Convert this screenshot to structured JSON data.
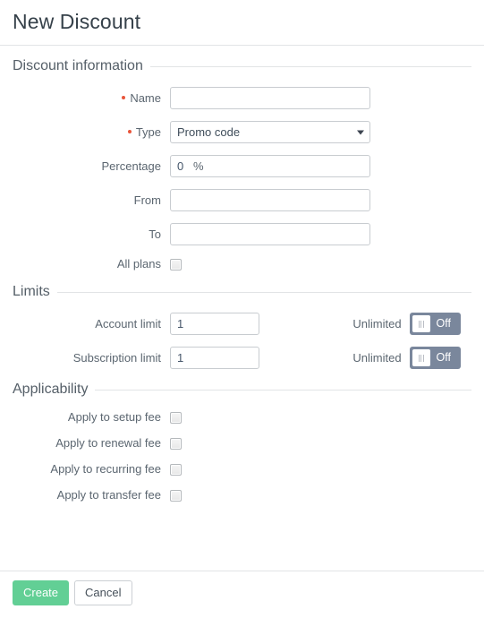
{
  "header": {
    "title": "New Discount"
  },
  "sections": {
    "discount_information": {
      "legend": "Discount information",
      "fields": {
        "name": {
          "label": "Name",
          "required": true,
          "value": "",
          "placeholder": ""
        },
        "type": {
          "label": "Type",
          "required": true,
          "selected": "Promo code",
          "caret_icon": "chevron-down-icon"
        },
        "percentage": {
          "label": "Percentage",
          "required": false,
          "value": "0",
          "suffix": "%"
        },
        "from": {
          "label": "From",
          "required": false,
          "value": "",
          "placeholder": ""
        },
        "to": {
          "label": "To",
          "required": false,
          "value": "",
          "placeholder": ""
        },
        "all_plans": {
          "label": "All plans",
          "checked": false
        }
      }
    },
    "limits": {
      "legend": "Limits",
      "rows": [
        {
          "label": "Account limit",
          "value": "1",
          "unlimited_label": "Unlimited",
          "toggle_state": "Off"
        },
        {
          "label": "Subscription limit",
          "value": "1",
          "unlimited_label": "Unlimited",
          "toggle_state": "Off"
        }
      ]
    },
    "applicability": {
      "legend": "Applicability",
      "rows": [
        {
          "label": "Apply to setup fee",
          "checked": false
        },
        {
          "label": "Apply to renewal fee",
          "checked": false
        },
        {
          "label": "Apply to recurring fee",
          "checked": false
        },
        {
          "label": "Apply to transfer fee",
          "checked": false
        }
      ]
    }
  },
  "footer": {
    "create_label": "Create",
    "cancel_label": "Cancel"
  },
  "colors": {
    "primary_green": "#62cf95",
    "required_dot": "#e8553a",
    "toggle_off": "#7a879c",
    "title_text": "#36414a",
    "border": "#e2e4e6"
  }
}
